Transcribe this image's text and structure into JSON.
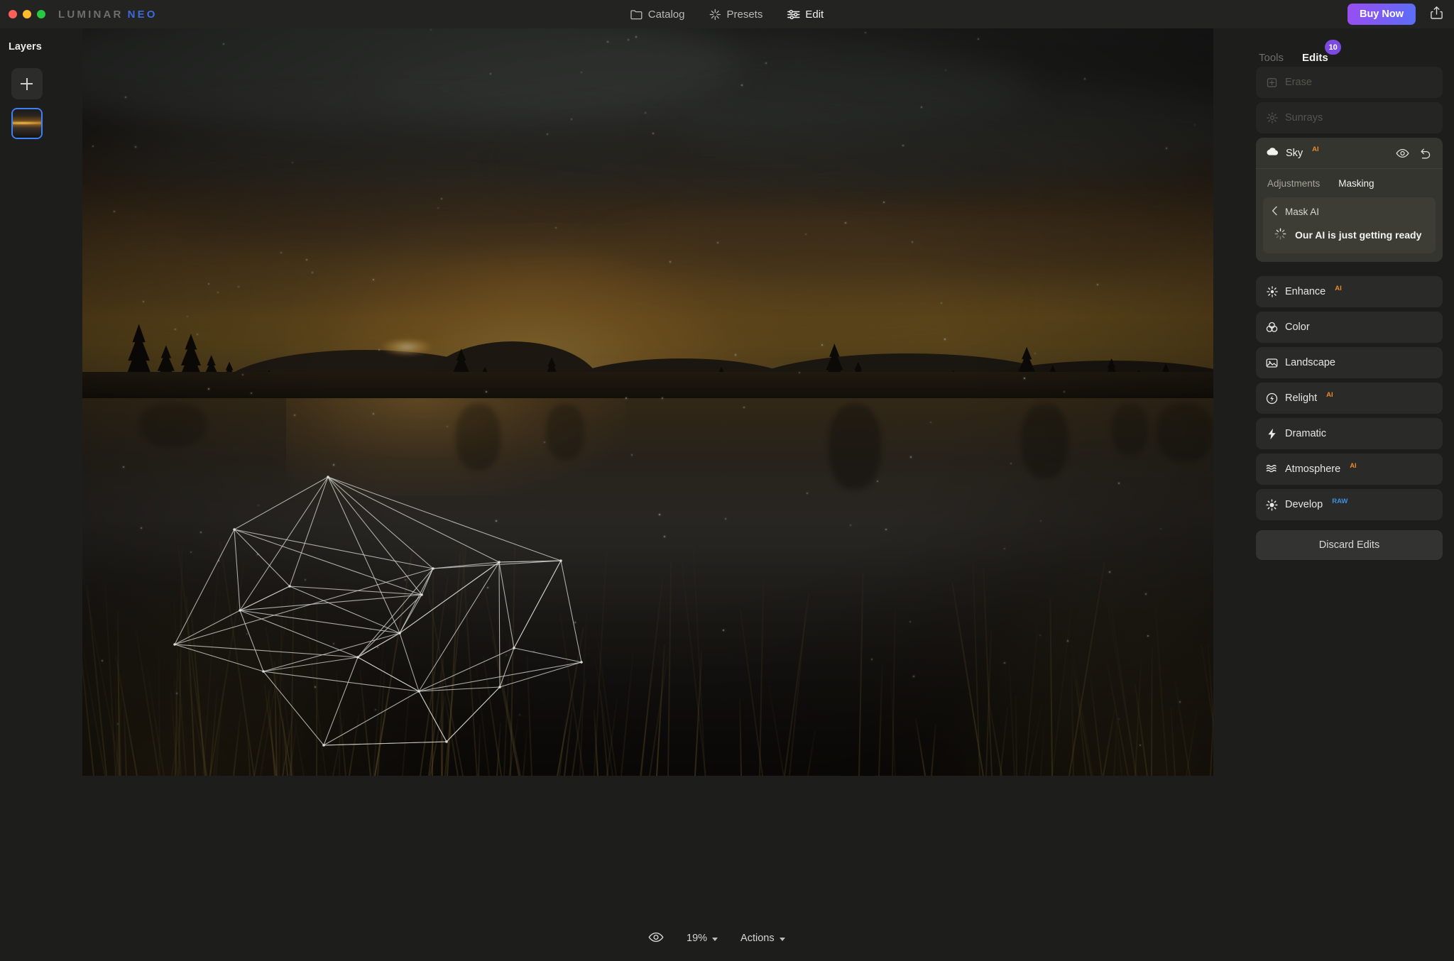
{
  "window": {
    "traffic_lights": [
      "close",
      "minimize",
      "maximize"
    ],
    "brand_primary": "LUMINAR",
    "brand_secondary": "NEO",
    "brand_secondary_color": "#3e6ad8"
  },
  "topnav": {
    "items": [
      {
        "label": "Catalog",
        "icon": "folder-icon",
        "active": false
      },
      {
        "label": "Presets",
        "icon": "sparkle-icon",
        "active": false
      },
      {
        "label": "Edit",
        "icon": "sliders-icon",
        "active": true
      }
    ],
    "buy_now": "Buy Now",
    "share_icon": "share-icon",
    "buy_now_color": "#7b5cf5"
  },
  "layers": {
    "title": "Layers",
    "add_label": "+",
    "thumbnails": [
      {
        "name": "layer-thumbnail-1",
        "selected": true
      }
    ],
    "selection_color": "#3f81f5"
  },
  "canvas": {
    "image_description": "Dark sunset landscape over a still lake with silhouetted pine trees, distant hills and foreground reeds",
    "mesh_overlay": "ai-processing-wireframe"
  },
  "bottombar": {
    "preview_icon": "eye-icon",
    "zoom_level": "19%",
    "actions_label": "Actions"
  },
  "right_panel": {
    "tabs": [
      {
        "label": "Tools",
        "active": false,
        "badge": null
      },
      {
        "label": "Edits",
        "active": true,
        "badge": "10"
      }
    ],
    "badge_color": "#7b4ae0",
    "disabled_tools": [
      {
        "label": "Erase",
        "icon": "eraser-icon",
        "badge": null
      },
      {
        "label": "Sunrays",
        "icon": "sunrays-icon",
        "badge": null
      }
    ],
    "sky_tool": {
      "label": "Sky",
      "badge": "AI",
      "icon": "cloud-icon",
      "visibility_icon": "eye-icon",
      "reset_icon": "undo-icon",
      "tabs": [
        {
          "label": "Adjustments",
          "active": false
        },
        {
          "label": "Masking",
          "active": true
        }
      ],
      "mask_panel": {
        "back_icon": "chevron-left-icon",
        "title": "Mask AI",
        "spinner_icon": "spinner-icon",
        "status": "Our AI is just getting ready"
      }
    },
    "tools": [
      {
        "label": "Enhance",
        "icon": "enhance-icon",
        "badge": "AI",
        "badge_kind": "ai"
      },
      {
        "label": "Color",
        "icon": "color-icon",
        "badge": null,
        "badge_kind": null
      },
      {
        "label": "Landscape",
        "icon": "landscape-icon",
        "badge": null,
        "badge_kind": null
      },
      {
        "label": "Relight",
        "icon": "relight-icon",
        "badge": "AI",
        "badge_kind": "ai"
      },
      {
        "label": "Dramatic",
        "icon": "dramatic-icon",
        "badge": null,
        "badge_kind": null
      },
      {
        "label": "Atmosphere",
        "icon": "atmosphere-icon",
        "badge": "AI",
        "badge_kind": "ai"
      },
      {
        "label": "Develop",
        "icon": "develop-icon",
        "badge": "RAW",
        "badge_kind": "raw"
      }
    ],
    "discard_label": "Discard Edits",
    "ai_badge_color": "#e8892b",
    "raw_badge_color": "#3e8fe0"
  }
}
